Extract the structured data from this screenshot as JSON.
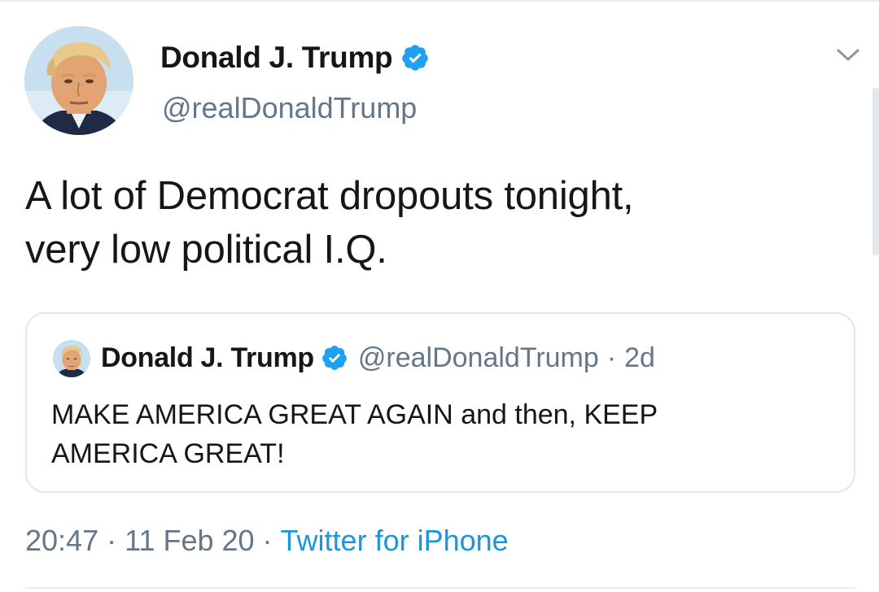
{
  "author": {
    "name": "Donald J. Trump",
    "handle": "@realDonaldTrump",
    "verified_icon": "verified-badge-icon",
    "verified_color": "#1da1f2"
  },
  "tweet": {
    "text": "A lot of Democrat dropouts tonight,\nvery low political I.Q."
  },
  "quoted_tweet": {
    "name": "Donald J. Trump",
    "handle": "@realDonaldTrump",
    "separator": "·",
    "time": "2d",
    "text": "MAKE AMERICA GREAT AGAIN and then, KEEP AMERICA GREAT!"
  },
  "meta": {
    "time": "20:47",
    "separator": "·",
    "date": "11 Feb 20",
    "source": "Twitter for iPhone"
  },
  "icons": {
    "menu": "chevron-down-icon",
    "avatar": "profile-photo"
  },
  "colors": {
    "text_primary": "#14171a",
    "text_secondary": "#657786",
    "link": "#1b95e0",
    "border": "#e1e8ed"
  }
}
